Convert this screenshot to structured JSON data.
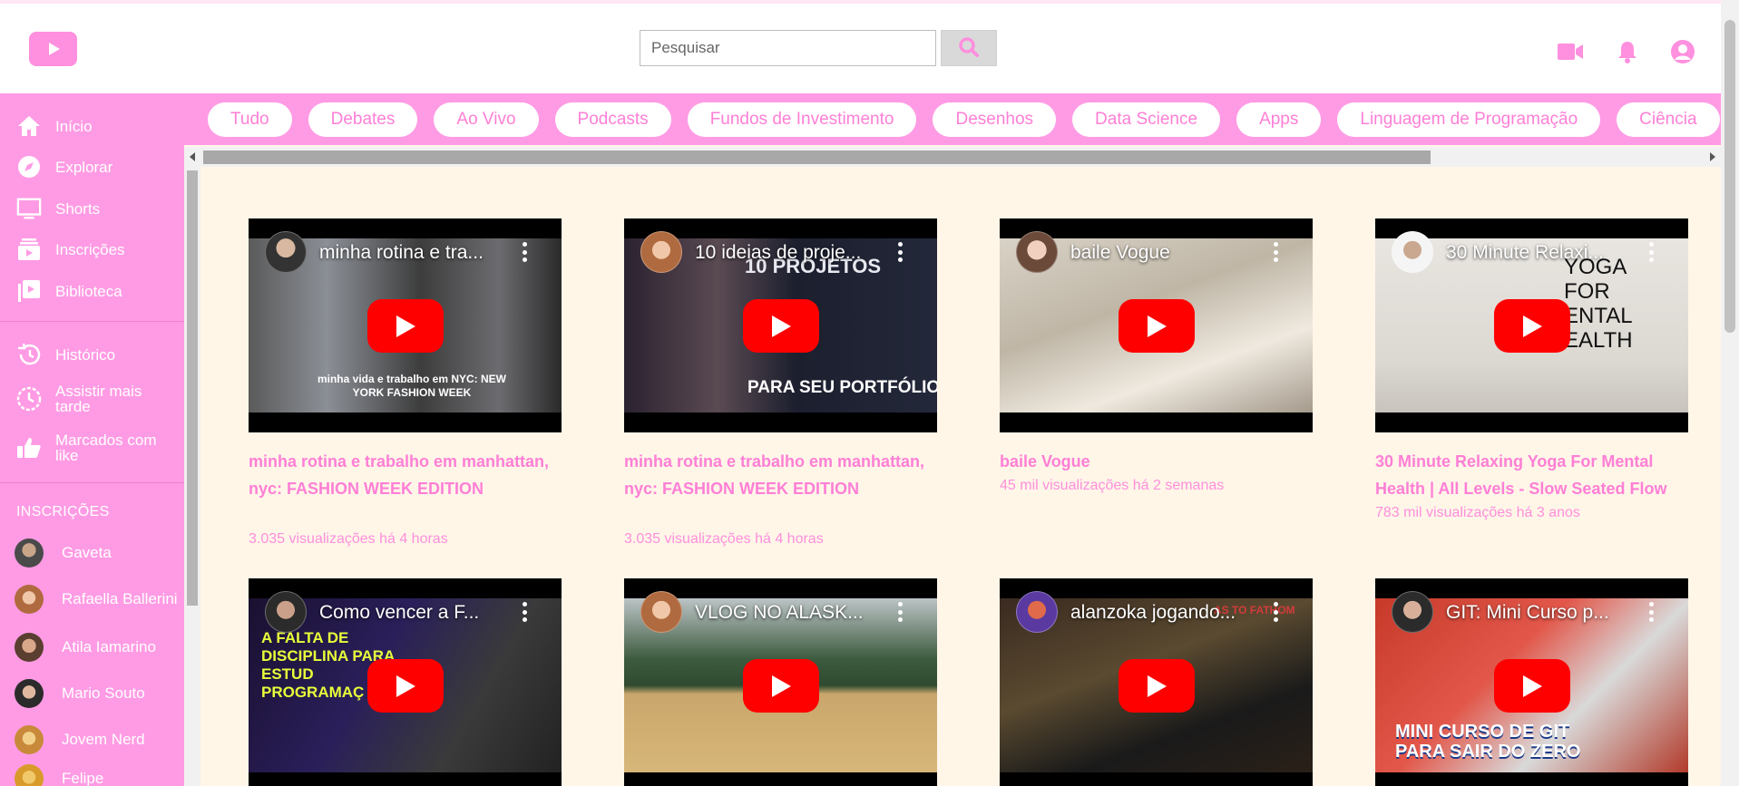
{
  "header": {
    "search_placeholder": "Pesquisar"
  },
  "sidebar": {
    "main_items": [
      {
        "label": "Início",
        "icon": "home-icon"
      },
      {
        "label": "Explorar",
        "icon": "compass-icon"
      },
      {
        "label": "Shorts",
        "icon": "shorts-icon"
      },
      {
        "label": "Inscrições",
        "icon": "subscriptions-icon"
      },
      {
        "label": "Biblioteca",
        "icon": "library-icon"
      }
    ],
    "secondary_items": [
      {
        "label": "Histórico",
        "icon": "history-icon"
      },
      {
        "label": "Assistir mais tarde",
        "icon": "clock-icon"
      },
      {
        "label": "Marcados com like",
        "icon": "thumbs-up-icon"
      }
    ],
    "subscriptions_heading": "INSCRIÇÕES",
    "subscriptions": [
      {
        "name": "Gaveta"
      },
      {
        "name": "Rafaella Ballerini"
      },
      {
        "name": "Atila Iamarino"
      },
      {
        "name": "Mario Souto"
      },
      {
        "name": "Jovem Nerd"
      },
      {
        "name": "Felipe"
      }
    ]
  },
  "chips": [
    "Tudo",
    "Debates",
    "Ao Vivo",
    "Podcasts",
    "Fundos de Investimento",
    "Desenhos",
    "Data Science",
    "Apps",
    "Linguagem de Programação",
    "Ciência"
  ],
  "videos": [
    {
      "overlay_title": "minha rotina e tra...",
      "title": "minha rotina e trabalho em manhattan, nyc: FASHION WEEK EDITION",
      "meta": "3.035 visualizações há 4 horas",
      "thumb_caption": "minha vida e trabalho em NYC: NEW YORK FASHION WEEK"
    },
    {
      "overlay_title": "10 ideias de proje...",
      "title": "minha rotina e trabalho em manhattan, nyc: FASHION WEEK EDITION",
      "meta": "3.035 visualizações há 4 horas",
      "thumb_caption_top": "10 PROJETOS",
      "thumb_caption_bottom": "PARA SEU PORTFÓLIO"
    },
    {
      "overlay_title": "baile Vogue",
      "title": "baile Vogue",
      "meta": "45 mil visualizações há 2 semanas"
    },
    {
      "overlay_title": "30 Minute Relaxi...",
      "title": "30 Minute Relaxing Yoga For Mental Health | All Levels - Slow Seated Flow",
      "meta": "783 mil visualizações há 3 anos",
      "thumb_caption": "YOGA\nFOR\nENTAL\nEALTH"
    },
    {
      "overlay_title": "Como vencer a F...",
      "thumb_caption": "A FALTA DE DISCIPLINA PARA ESTUD PROGRAMAÇ"
    },
    {
      "overlay_title": "VLOG NO ALASK..."
    },
    {
      "overlay_title": "alanzoka jogando...",
      "thumb_caption": "AS TO FATHOM"
    },
    {
      "overlay_title": "GIT: Mini Curso p...",
      "thumb_caption": "MINI CURSO DE GIT PARA SAIR DO ZERO"
    }
  ],
  "colors": {
    "sidebar_bg": "#ff9be4",
    "accent": "#ff7fd6",
    "main_bg": "#fff6e8",
    "play_red": "#ff0000"
  }
}
